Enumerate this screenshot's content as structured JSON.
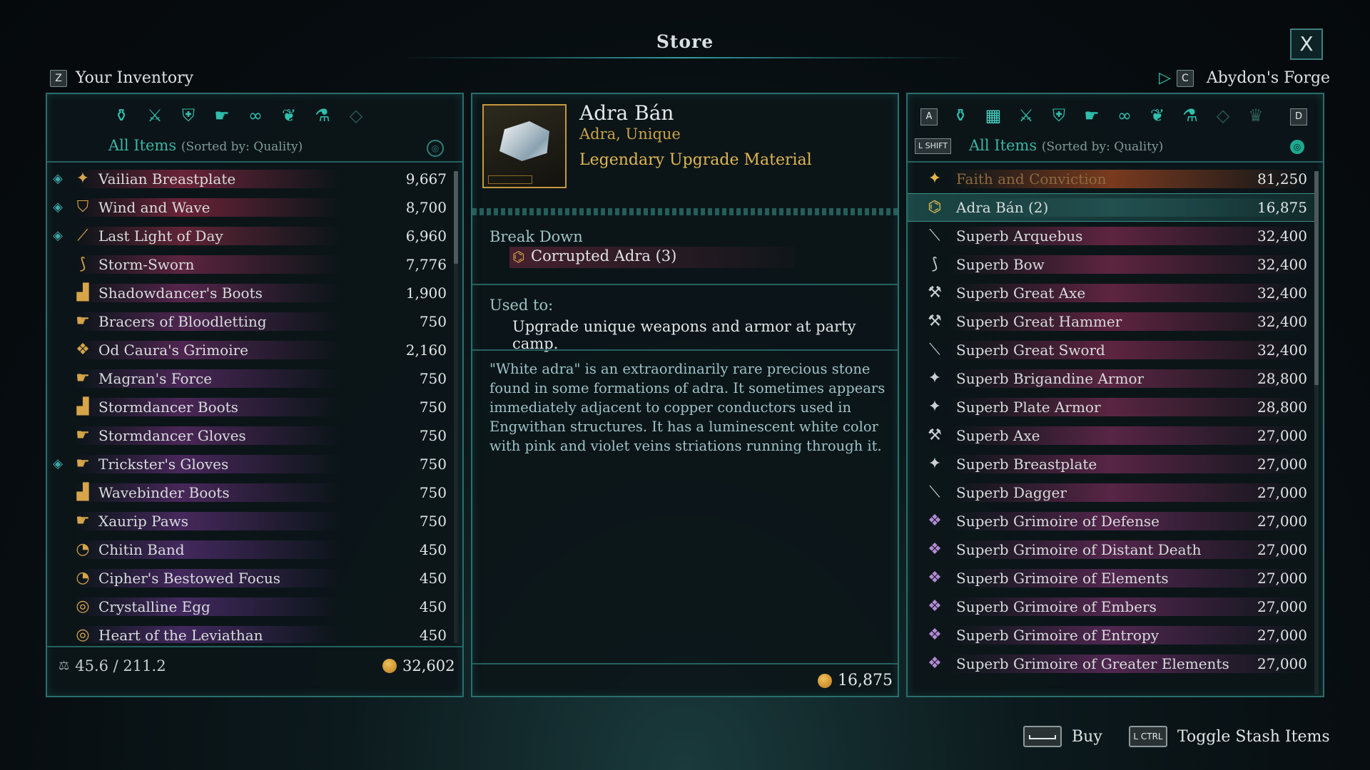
{
  "header": {
    "title": "Store",
    "close_label": "X"
  },
  "left_header": {
    "key": "Z",
    "label": "Your Inventory"
  },
  "right_header": {
    "key": "C",
    "label": "Abydon's Forge"
  },
  "inventory": {
    "filter_label": "All Items",
    "sort_label": "(Sorted by: Quality)",
    "categories": [
      "all-items-icon",
      "weapons-icon",
      "armor-icon",
      "accessories-icon",
      "rings-icon",
      "grimoires-icon",
      "consumables-icon",
      "gems-icon"
    ],
    "items": [
      {
        "name": "Vailian Breastplate",
        "value": "9,667",
        "mark": "◈",
        "icon": "✦",
        "bar": "#6a2338"
      },
      {
        "name": "Wind and Wave",
        "value": "8,700",
        "mark": "◈",
        "icon": "⛉",
        "bar": "#6a2338"
      },
      {
        "name": "Last Light of Day",
        "value": "6,960",
        "mark": "◈",
        "icon": "⟋",
        "bar": "#5f2436"
      },
      {
        "name": "Storm-Sworn",
        "value": "7,776",
        "mark": "",
        "icon": "⟆",
        "bar": "#5d2440"
      },
      {
        "name": "Shadowdancer's Boots",
        "value": "1,900",
        "mark": "",
        "icon": "▟",
        "bar": "#55254a"
      },
      {
        "name": "Bracers of Bloodletting",
        "value": "750",
        "mark": "",
        "icon": "☛",
        "bar": "#4e2550"
      },
      {
        "name": "Od Caura's Grimoire",
        "value": "2,160",
        "mark": "",
        "icon": "❖",
        "bar": "#4e2550"
      },
      {
        "name": "Magran's Force",
        "value": "750",
        "mark": "",
        "icon": "☛",
        "bar": "#4a2656"
      },
      {
        "name": "Stormdancer Boots",
        "value": "750",
        "mark": "",
        "icon": "▟",
        "bar": "#4a2656"
      },
      {
        "name": "Stormdancer Gloves",
        "value": "750",
        "mark": "",
        "icon": "☛",
        "bar": "#4a2656"
      },
      {
        "name": "Trickster's Gloves",
        "value": "750",
        "mark": "◈",
        "icon": "☛",
        "bar": "#48275a"
      },
      {
        "name": "Wavebinder Boots",
        "value": "750",
        "mark": "",
        "icon": "▟",
        "bar": "#48275a"
      },
      {
        "name": "Xaurip Paws",
        "value": "750",
        "mark": "",
        "icon": "☛",
        "bar": "#46285c"
      },
      {
        "name": "Chitin Band",
        "value": "450",
        "mark": "",
        "icon": "◔",
        "bar": "#44285e"
      },
      {
        "name": "Cipher's Bestowed Focus",
        "value": "450",
        "mark": "",
        "icon": "◔",
        "bar": "#44285e"
      },
      {
        "name": "Crystalline Egg",
        "value": "450",
        "mark": "",
        "icon": "◎",
        "bar": "#42285e"
      },
      {
        "name": "Heart of the Leviathan",
        "value": "450",
        "mark": "",
        "icon": "◎",
        "bar": "#42285e"
      }
    ],
    "weight": "45.6 / 211.2",
    "money": "32,602"
  },
  "detail": {
    "name": "Adra Bán",
    "subtitle": "Adra, Unique",
    "type": "Legendary Upgrade Material",
    "breakdown_label": "Break Down",
    "breakdown_item": "Corrupted Adra (3)",
    "used_label": "Used to:",
    "used_text": "Upgrade unique weapons and armor at party camp.",
    "lore": "\"White adra\" is an extraordinarily rare precious stone found in some formations of adra. It sometimes appears immediately adjacent to copper conductors used in Engwithan structures. It has a luminescent white color with pink and violet veins striations running through it.",
    "price": "16,875"
  },
  "store": {
    "left_key": "A",
    "right_key": "D",
    "shift_key": "L SHIFT",
    "filter_label": "All Items",
    "sort_label": "(Sorted by: Quality)",
    "categories": [
      "all-items-icon",
      "stash-icon",
      "crates-icon",
      "weapons-icon",
      "armor-icon",
      "accessories-icon",
      "rings-icon",
      "grimoires-icon",
      "consumables-icon",
      "gems-icon",
      "crown-icon"
    ],
    "items": [
      {
        "name": "Faith and Conviction",
        "value": "81,250",
        "icon": "✦",
        "bar": "#7a3a1f"
      },
      {
        "name": "Adra Bán (2)",
        "value": "16,875",
        "icon": "⌬",
        "bar": "#22504f"
      },
      {
        "name": "Superb Arquebus",
        "value": "32,400",
        "icon": "⟍",
        "bar": "#5e2440"
      },
      {
        "name": "Superb Bow",
        "value": "32,400",
        "icon": "⟆",
        "bar": "#5e2440"
      },
      {
        "name": "Superb Great Axe",
        "value": "32,400",
        "icon": "⚒",
        "bar": "#5e2440"
      },
      {
        "name": "Superb Great Hammer",
        "value": "32,400",
        "icon": "⚒",
        "bar": "#5e2440"
      },
      {
        "name": "Superb Great Sword",
        "value": "32,400",
        "icon": "⟍",
        "bar": "#5e2440"
      },
      {
        "name": "Superb Brigandine Armor",
        "value": "28,800",
        "icon": "✦",
        "bar": "#5a2542"
      },
      {
        "name": "Superb Plate Armor",
        "value": "28,800",
        "icon": "✦",
        "bar": "#5a2542"
      },
      {
        "name": "Superb Axe",
        "value": "27,000",
        "icon": "⚒",
        "bar": "#582546"
      },
      {
        "name": "Superb Breastplate",
        "value": "27,000",
        "icon": "✦",
        "bar": "#582546"
      },
      {
        "name": "Superb Dagger",
        "value": "27,000",
        "icon": "⟍",
        "bar": "#582546"
      },
      {
        "name": "Superb Grimoire of Defense",
        "value": "27,000",
        "icon": "❖",
        "bar": "#54264c"
      },
      {
        "name": "Superb Grimoire of Distant Death",
        "value": "27,000",
        "icon": "❖",
        "bar": "#54264c"
      },
      {
        "name": "Superb Grimoire of Elements",
        "value": "27,000",
        "icon": "❖",
        "bar": "#52264e"
      },
      {
        "name": "Superb Grimoire of Embers",
        "value": "27,000",
        "icon": "❖",
        "bar": "#52264e"
      },
      {
        "name": "Superb Grimoire of Entropy",
        "value": "27,000",
        "icon": "❖",
        "bar": "#502750"
      },
      {
        "name": "Superb Grimoire of Greater Elements",
        "value": "27,000",
        "icon": "❖",
        "bar": "#502750"
      }
    ]
  },
  "footer": {
    "buy_key": "SPACE",
    "buy_label": "Buy",
    "stash_key": "L CTRL",
    "stash_label": "Toggle Stash Items"
  },
  "colors": {
    "accent": "#2fbfae",
    "panel_border": "#2a6e6c",
    "gold": "#e0b653"
  }
}
